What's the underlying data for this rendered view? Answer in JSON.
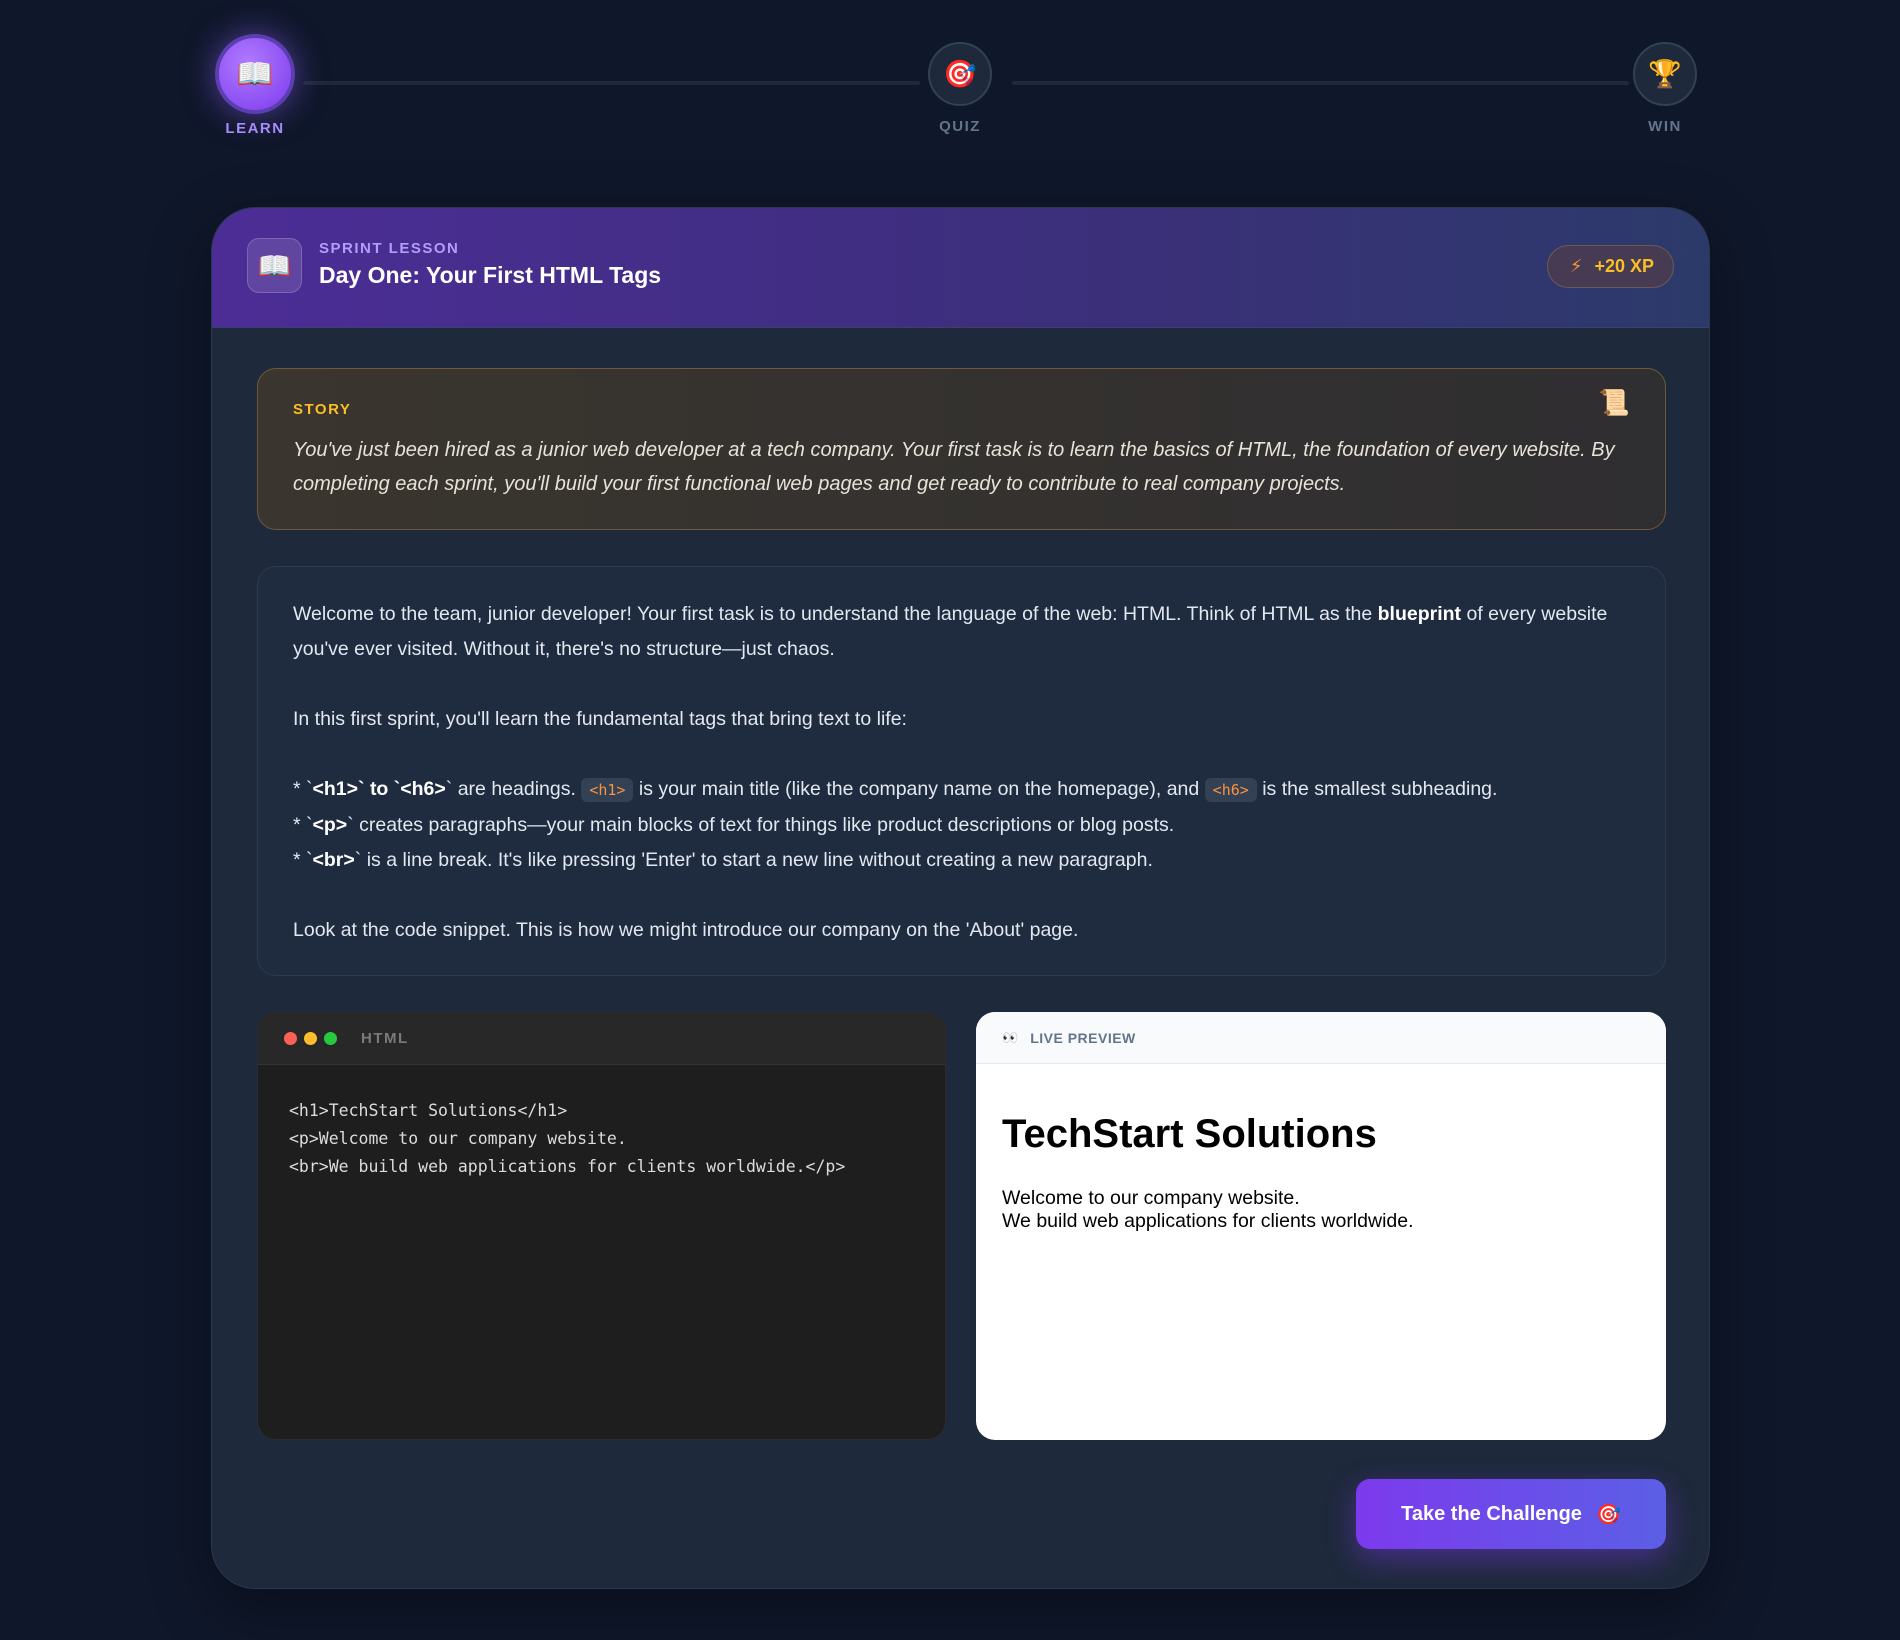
{
  "steps": [
    {
      "label": "LEARN",
      "icon": "📖",
      "icon_name": "book-icon",
      "active": true
    },
    {
      "label": "QUIZ",
      "icon": "🎯",
      "icon_name": "target-icon",
      "active": false
    },
    {
      "label": "WIN",
      "icon": "🏆",
      "icon_name": "trophy-icon",
      "active": false
    }
  ],
  "header": {
    "icon": "📖",
    "kicker": "SPRINT LESSON",
    "title": "Day One: Your First HTML Tags",
    "xp_icon": "⚡",
    "xp": "+20 XP"
  },
  "story": {
    "label": "STORY",
    "icon": "📜",
    "text": "You've just been hired as a junior web developer at a tech company. Your first task is to learn the basics of HTML, the foundation of every website. By completing each sprint, you'll build your first functional web pages and get ready to contribute to real company projects."
  },
  "lesson": {
    "p1_before": "Welcome to the team, junior developer! Your first task is to understand the language of the web: HTML. Think of HTML as the ",
    "p1_bold": "blueprint",
    "p1_after": " of every website you've ever visited. Without it, there's no structure—just chaos.",
    "p2": "In this first sprint, you'll learn the fundamental tags that bring text to life:",
    "b1_prefix": "* `",
    "b1_bold": "<h1>` to `<h6>",
    "b1_tick": "`",
    "b1_mid": " are headings. ",
    "b1_code1": "<h1>",
    "b1_mid2": " is your main title (like the company name on the homepage), and ",
    "b1_code2": "<h6>",
    "b1_end": " is the smallest subheading.",
    "b2_prefix": "* `",
    "b2_bold": "<p>",
    "b2_tick": "`",
    "b2_text": " creates paragraphs—your main blocks of text for things like product descriptions or blog posts.",
    "b3_prefix": "* `",
    "b3_bold": "<br>",
    "b3_tick": "`",
    "b3_text": " is a line break. It's like pressing 'Enter' to start a new line without creating a new paragraph.",
    "p3": "Look at the code snippet. This is how we might introduce our company on the 'About' page."
  },
  "code": {
    "lang": "HTML",
    "dot_colors": [
      "#ff5f56",
      "#ffbd2e",
      "#27c93f"
    ],
    "text": "<h1>TechStart Solutions</h1>\n<p>Welcome to our company website.\n<br>We build web applications for clients worldwide.</p>"
  },
  "preview": {
    "icon": "👀",
    "label": "LIVE PREVIEW",
    "heading": "TechStart Solutions",
    "line1": "Welcome to our company website.",
    "line2": "We build web applications for clients worldwide."
  },
  "cta": {
    "label": "Take the Challenge",
    "icon": "🎯"
  },
  "colors": {
    "background": "#0f172a",
    "card": "#1e293b",
    "accent": "#7c3aed",
    "xp": "#fbbf24",
    "code_tag": "#fb923c"
  }
}
